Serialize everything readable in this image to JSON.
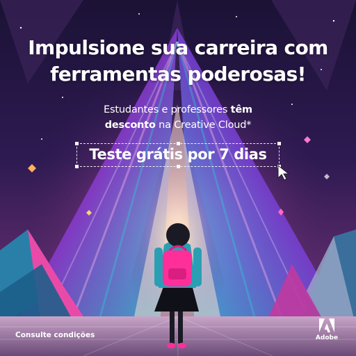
{
  "ad": {
    "headline_line1": "Impulsione sua carreira com",
    "headline_line2": "ferramentas poderosas!",
    "sub_line1": "Estudantes e professores ",
    "sub_line1_bold": "têm",
    "sub_line2_bold": "desconto",
    "sub_line2": " na Creative Cloud*",
    "cta_label": "Teste grátis por 7 dias",
    "footer_link": "Consulte condições",
    "brand_name": "Adobe"
  },
  "icons": {
    "cursor": "cursor-arrow-icon",
    "brand": "adobe-logo-icon"
  },
  "colors": {
    "sky_top": "#1a1040",
    "sky_mid": "#3b1c5c",
    "accent_pink": "#ff2fae",
    "accent_teal": "#2fd0d8",
    "backpack_pink": "#ff2f9a",
    "jacket_teal": "#2a9fb3",
    "text": "#ffffff"
  }
}
